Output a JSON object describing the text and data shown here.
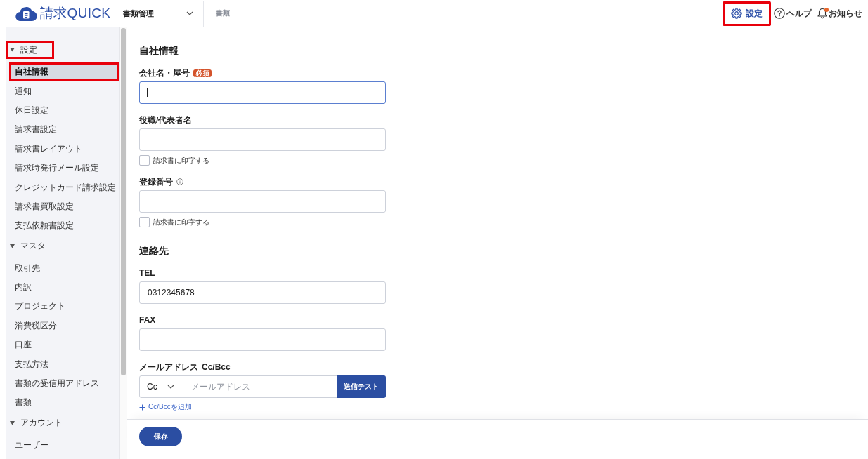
{
  "header": {
    "logo": "請求QUICK",
    "product_menu": "書類管理",
    "breadcrumb": "書類",
    "actions": [
      {
        "kind": "settings",
        "label": "設定",
        "highlighted": true,
        "unread": false
      },
      {
        "kind": "help",
        "label": "ヘルプ",
        "highlighted": false,
        "unread": false
      },
      {
        "kind": "notifications",
        "label": "お知らせ",
        "highlighted": false,
        "unread": true
      }
    ]
  },
  "sidebar": {
    "groups": [
      {
        "label": "設定",
        "expanded": true,
        "highlighted": true,
        "children": [
          {
            "label": "自社情報",
            "selected": true,
            "highlighted": true
          },
          {
            "label": "通知",
            "selected": false,
            "highlighted": false
          },
          {
            "label": "休日設定",
            "selected": false,
            "highlighted": false
          },
          {
            "label": "請求書設定",
            "selected": false,
            "highlighted": false
          },
          {
            "label": "請求書レイアウト",
            "selected": false,
            "highlighted": false
          },
          {
            "label": "請求時発行メール設定",
            "selected": false,
            "highlighted": false
          },
          {
            "label": "クレジットカード請求設定",
            "selected": false,
            "highlighted": false
          },
          {
            "label": "請求書買取設定",
            "selected": false,
            "highlighted": false
          },
          {
            "label": "支払依頼書設定",
            "selected": false,
            "highlighted": false
          }
        ]
      },
      {
        "label": "マスタ",
        "expanded": true,
        "highlighted": false,
        "children": [
          {
            "label": "取引先",
            "selected": false,
            "highlighted": false
          },
          {
            "label": "内訳",
            "selected": false,
            "highlighted": false
          },
          {
            "label": "プロジェクト",
            "selected": false,
            "highlighted": false
          },
          {
            "label": "消費税区分",
            "selected": false,
            "highlighted": false
          },
          {
            "label": "口座",
            "selected": false,
            "highlighted": false
          },
          {
            "label": "支払方法",
            "selected": false,
            "highlighted": false
          },
          {
            "label": "書類の受信用アドレス",
            "selected": false,
            "highlighted": false
          },
          {
            "label": "書類",
            "selected": false,
            "highlighted": false
          }
        ]
      },
      {
        "label": "アカウント",
        "expanded": true,
        "highlighted": false,
        "children": [
          {
            "label": "ユーザー",
            "selected": false,
            "highlighted": false
          }
        ]
      }
    ]
  },
  "form": {
    "sections": [
      {
        "title": "自社情報",
        "fields": [
          {
            "kind": "text",
            "label": "会社名・屋号",
            "badge": "必須",
            "focused": true
          },
          {
            "kind": "text",
            "label": "役職/代表者名",
            "focused": false,
            "print_option": {
              "label": "請求書に印字する",
              "checked": false
            }
          },
          {
            "kind": "text",
            "label": "登録番号",
            "info": true,
            "focused": false,
            "print_option": {
              "label": "請求書に印字する",
              "checked": false
            }
          }
        ]
      },
      {
        "title": "連絡先",
        "fields": [
          {
            "kind": "text",
            "label": "TEL",
            "value": "0312345678",
            "focused": false
          },
          {
            "kind": "text",
            "label": "FAX",
            "focused": false
          },
          {
            "kind": "email",
            "label": "メールアドレス",
            "sublabel": "Cc/Bcc",
            "select": "Cc",
            "placeholder": "メールアドレス",
            "button": "送信テスト",
            "add_link": "Cc/Bccを追加"
          }
        ]
      }
    ]
  },
  "footer": {
    "save_button": "保存"
  }
}
